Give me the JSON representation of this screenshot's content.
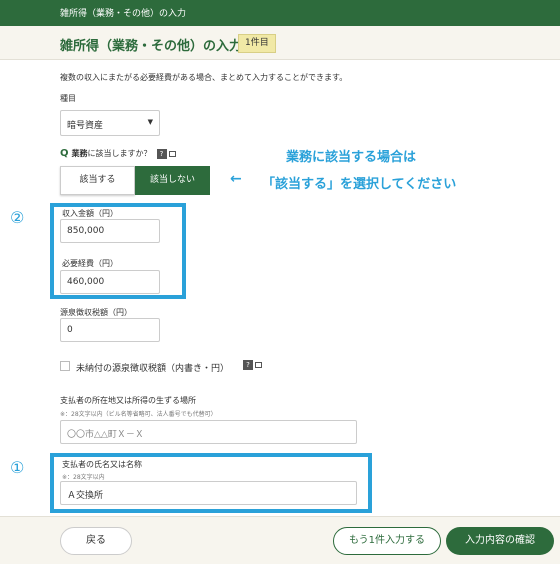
{
  "topbar": {
    "title": "雑所得（業務・その他）の入力"
  },
  "header": {
    "title": "雑所得（業務・その他）の入力",
    "count_badge": "1件目"
  },
  "intro": "複数の収入にまたがる必要経費がある場合、まとめて入力することができます。",
  "type_field": {
    "label": "種目",
    "value": "暗号資産"
  },
  "business_question": {
    "q_mark": "Q",
    "bold_text": "業務",
    "text": "に該当しますか？",
    "help_icon": "?",
    "yes_label": "該当する",
    "no_label": "該当しない",
    "selected": "該当しない"
  },
  "annotation": {
    "line1": "業務に該当する場合は",
    "arrow": "←",
    "line2": "「該当する」を選択してください",
    "num2": "②",
    "num1": "①",
    "color": "#2aa1d9"
  },
  "income": {
    "label": "収入金額（円）",
    "value": "850,000"
  },
  "expenses": {
    "label": "必要経費（円）",
    "value": "460,000"
  },
  "withholding": {
    "label": "源泉徴収税額（円）",
    "value": "0"
  },
  "unpaid_checkbox": {
    "label": "未納付の源泉徴収税額（内書き・円）",
    "help_icon": "?",
    "checked": false
  },
  "payer_address": {
    "label": "支払者の所在地又は所得の生ずる場所",
    "note": "※：28文字以内（ビル名等省略可、法人番号でも代替可）",
    "placeholder": "〇〇市△△町Ｘ－Ｘ"
  },
  "payer_name": {
    "label": "支払者の氏名又は名称",
    "note": "※：28文字以内",
    "value": "Ａ交換所"
  },
  "footer": {
    "back": "戻る",
    "add_more": "もう1件入力する",
    "confirm": "入力内容の確認"
  },
  "colors": {
    "primary": "#2d6b3c",
    "accent": "#2aa1d9",
    "badge": "#f1e9a6"
  }
}
